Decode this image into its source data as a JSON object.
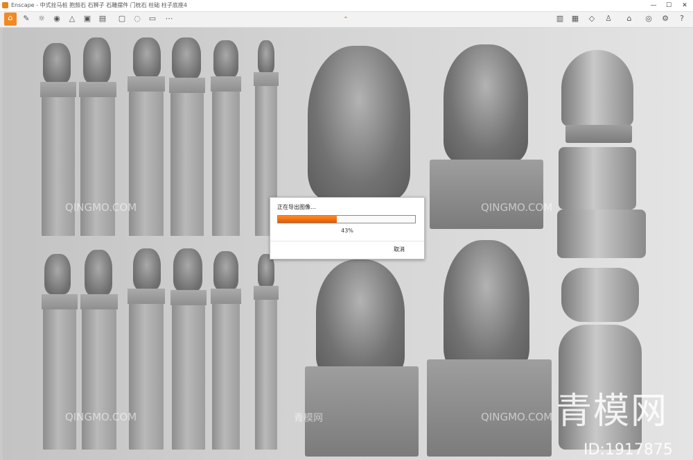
{
  "window": {
    "app_name": "Enscape",
    "title": "中式拴马桩 抱鼓石 石狮子 石雕摆件 门枕石 柱础 柱子底座4",
    "minimize_glyph": "—",
    "maximize_glyph": "☐",
    "close_glyph": "✕"
  },
  "toolbar": {
    "left_icons": [
      "home-icon",
      "walk-icon",
      "sun-icon",
      "eye-icon",
      "view-icon",
      "capture-icon",
      "batch-icon",
      "video-icon",
      "panorama-icon",
      "asset-icon",
      "more-icon"
    ],
    "right_icons": [
      "book-icon",
      "screenshot-icon",
      "cube-icon",
      "person-icon",
      "house-icon",
      "eye-icon",
      "settings-icon",
      "help-icon"
    ],
    "collapse_glyph": "⌃"
  },
  "export_dialog": {
    "title": "正在导出图像…",
    "progress_percent": 43,
    "progress_label": "43%",
    "cancel_label": "取消",
    "accent_color": "#f07a1a"
  },
  "watermarks": {
    "qingmo": "QINGMO.COM",
    "qingmo_cn": "青模网",
    "big_logo": "青模网",
    "id_text": "ID:1917875"
  }
}
